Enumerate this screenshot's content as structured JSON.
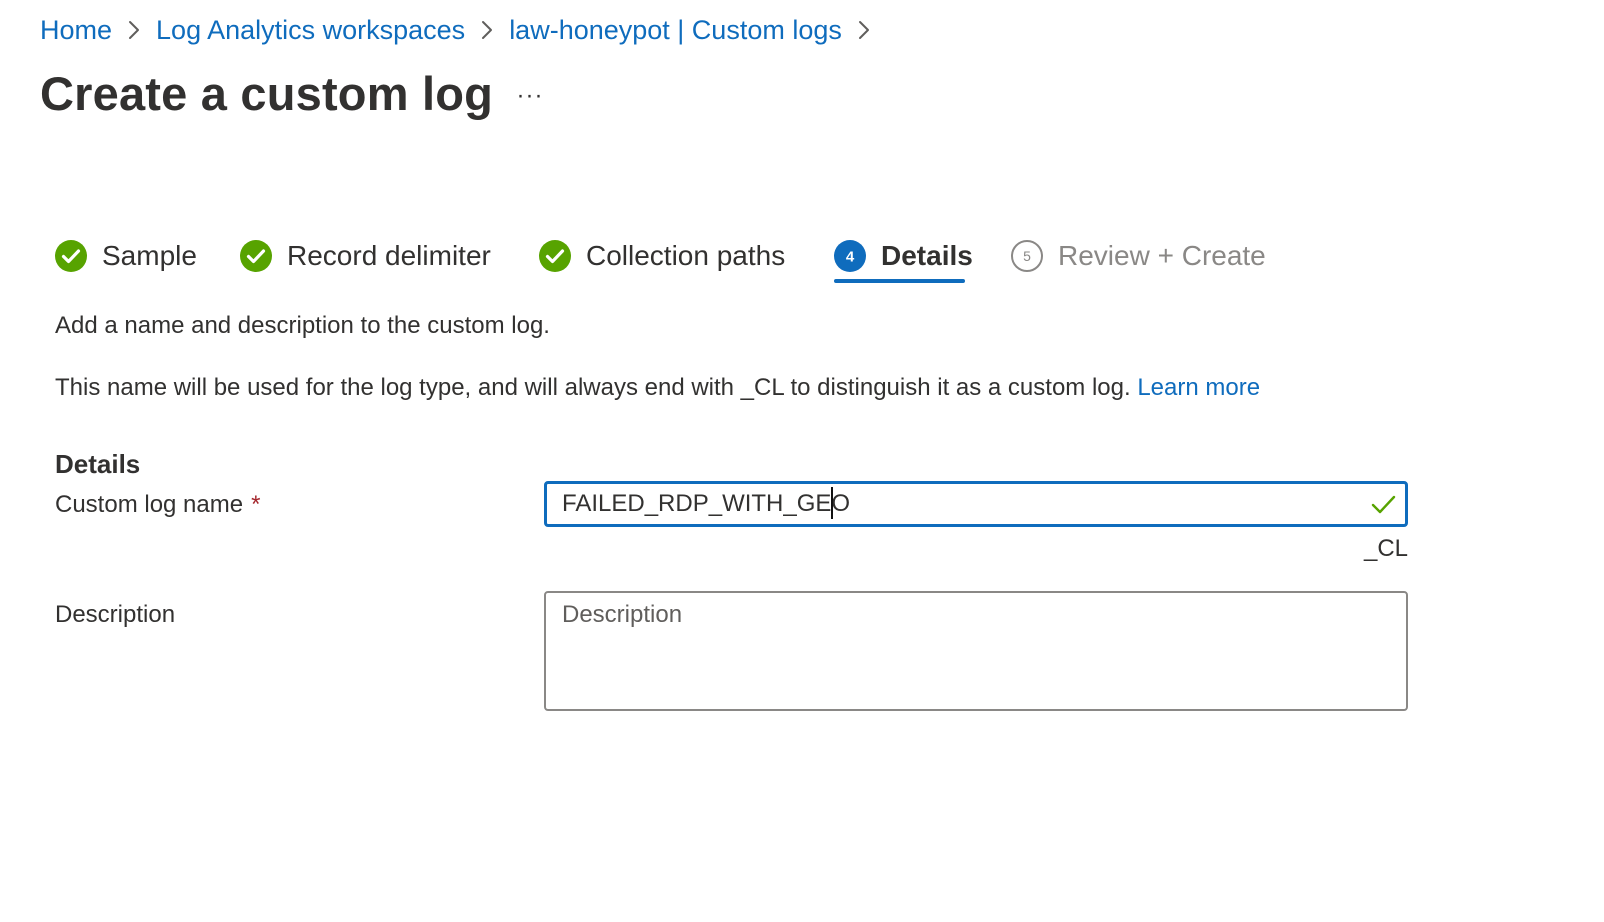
{
  "breadcrumb": {
    "items": [
      {
        "label": "Home"
      },
      {
        "label": "Log Analytics workspaces"
      },
      {
        "label": "law-honeypot | Custom logs"
      }
    ]
  },
  "page": {
    "title": "Create a custom log",
    "more_label": "···"
  },
  "wizard": {
    "steps": [
      {
        "label": "Sample",
        "status": "completed"
      },
      {
        "label": "Record delimiter",
        "status": "completed"
      },
      {
        "label": "Collection paths",
        "status": "completed"
      },
      {
        "label": "Details",
        "status": "current",
        "number": "4"
      },
      {
        "label": "Review + Create",
        "status": "upcoming",
        "number": "5"
      }
    ]
  },
  "content": {
    "intro": "Add a name and description to the custom log.",
    "info_text": "This name will be used for the log type, and will always end with _CL to distinguish it as a custom log.",
    "learn_more": "Learn more"
  },
  "form": {
    "section_title": "Details",
    "name": {
      "label": "Custom log name",
      "required_mark": "*",
      "value": "FAILED_RDP_WITH_GEO",
      "suffix": "_CL",
      "valid": true
    },
    "description": {
      "label": "Description",
      "placeholder": "Description",
      "value": ""
    }
  },
  "colors": {
    "link": "#0f6cbd",
    "success": "#57a300",
    "primary": "#0f6cbd",
    "required": "#a4262c",
    "muted": "#8a8886"
  },
  "icons": {
    "breadcrumb_separator": "chevron-right-icon",
    "step_completed": "check-circle-icon",
    "step_current": "numbered-circle-filled-icon",
    "step_upcoming": "numbered-circle-outline-icon",
    "input_valid": "checkmark-icon",
    "more": "more-horizontal-icon"
  }
}
